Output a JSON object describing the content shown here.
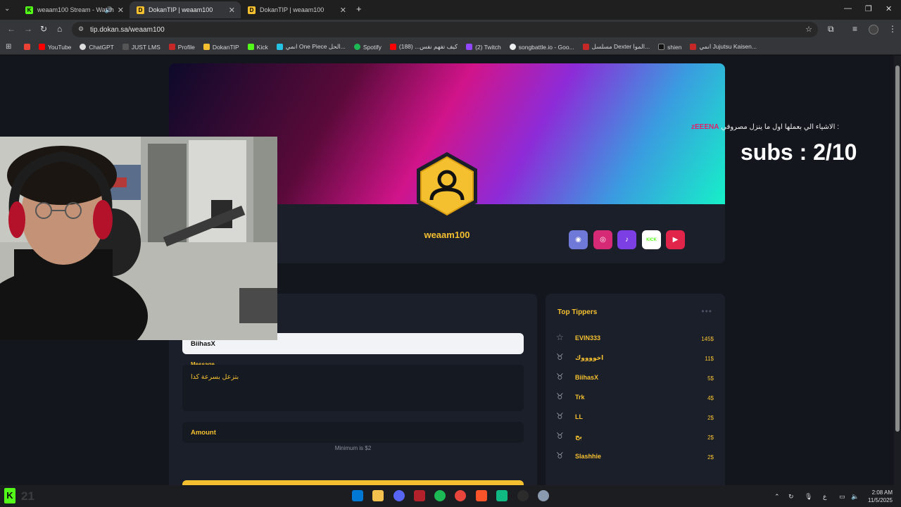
{
  "browser": {
    "tabs": [
      {
        "label": "weaam100 Stream - Watch",
        "active": false
      },
      {
        "label": "DokanTIP | weaam100",
        "active": true
      },
      {
        "label": "DokanTIP | weaam100",
        "active": false
      }
    ],
    "url": "tip.dokan.sa/weaam100",
    "bookmarks": [
      "YouTube",
      "ChatGPT",
      "JUST LMS",
      "Profile",
      "DokanTIP",
      "Kick",
      "انمي One Piece الحل...",
      "Spotify",
      "كيف تفهم نفس... (188)",
      "(2) Twitch",
      "songbattle.io - Goo...",
      "مسلسل Dexter الموا...",
      "shien",
      "انمي Jujutsu Kaisen..."
    ]
  },
  "profile": {
    "username": "weaam100",
    "social": [
      {
        "name": "discord",
        "color": "#5865f2",
        "glyph": "◉"
      },
      {
        "name": "instagram",
        "color": "#d62976",
        "glyph": "◎"
      },
      {
        "name": "tiktok",
        "color": "#7b3fe4",
        "glyph": "♪"
      },
      {
        "name": "kick",
        "color": "#ffffff",
        "glyph": "KICK"
      },
      {
        "name": "youtube",
        "color": "#e0244a",
        "glyph": "▶"
      }
    ]
  },
  "form": {
    "name_value": "BiihasX",
    "message_label": "Message",
    "message_value": "بتزعل بسرعة كدا",
    "amount_placeholder": "Amount",
    "minimum_note": "Minimum is $2"
  },
  "tippers": {
    "title": "Top Tippers",
    "list": [
      {
        "name": "EVIN333",
        "amount": "145$"
      },
      {
        "name": "اخووووك",
        "amount": "11$"
      },
      {
        "name": "BiihasX",
        "amount": "5$"
      },
      {
        "name": "Trk",
        "amount": "4$"
      },
      {
        "name": "LL",
        "amount": "2$"
      },
      {
        "name": "بخ",
        "amount": "2$"
      },
      {
        "name": "Slashhie",
        "amount": "2$"
      }
    ]
  },
  "overlay": {
    "line_text": "الاشياء الي بعملها اول ما ينزل مصروفي",
    "highlight": "zEEENA",
    "line_suffix": " :",
    "subs": "subs : 2/10"
  },
  "taskbar": {
    "left_number": "21",
    "lang": "ع",
    "time": "2:08 AM",
    "date": "11/5/2025"
  }
}
